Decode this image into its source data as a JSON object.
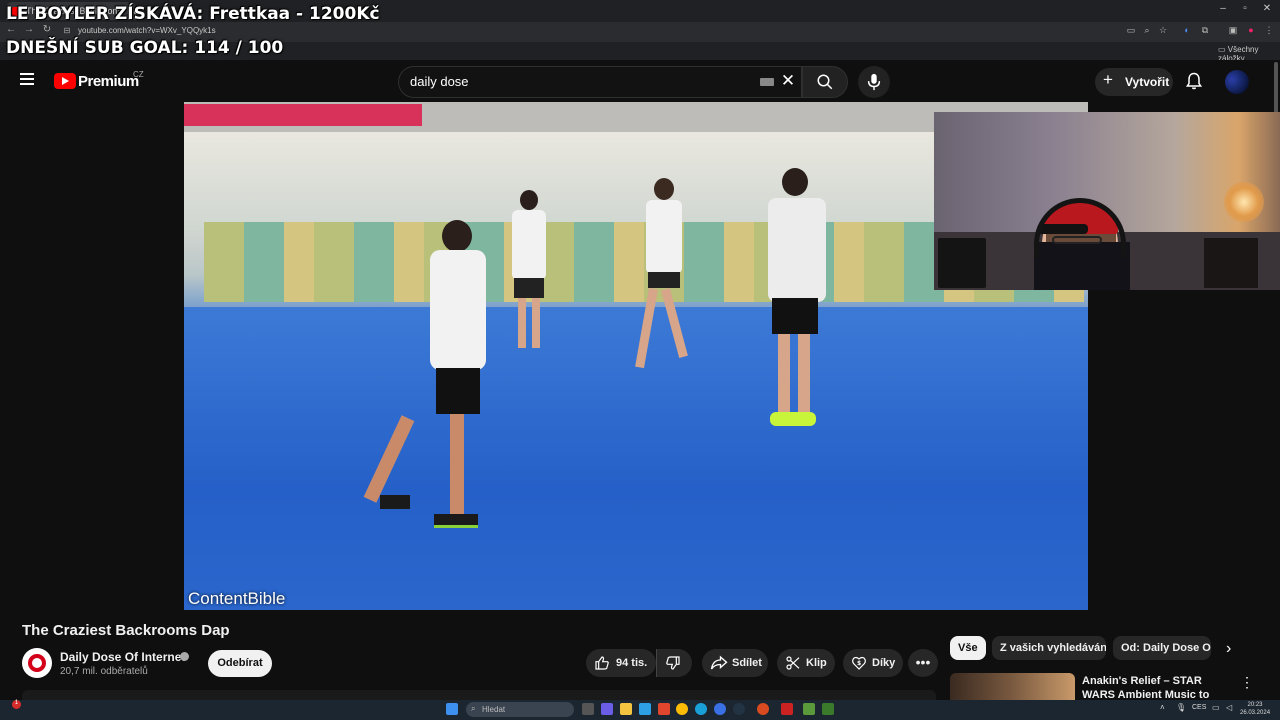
{
  "browser": {
    "tab_title": "The Craziest Backrooms Da...",
    "url": "youtube.com/watch?v=WXv_YQQyk1s",
    "bookmarks_all": "Všechny záložky"
  },
  "overlays": {
    "donation": "LE BOYLER ZÍSKÁVÁ: Frettkaa - 1200Kč",
    "subgoal": "DNEŠNÍ SUB GOAL: 114 / 100"
  },
  "header": {
    "logo_text": "Premium",
    "country": "CZ",
    "search_value": "daily dose",
    "create_label": "Vytvořit"
  },
  "video": {
    "watermark": "ContentBible",
    "title": "The Craziest Backrooms Dap"
  },
  "channel": {
    "name": "Daily Dose Of Internet",
    "subscribers": "20,7 mil. odběratelů",
    "subscribe_label": "Odebírat"
  },
  "actions": {
    "likes": "94 tis.",
    "share": "Sdílet",
    "clip": "Klip",
    "thanks": "Díky",
    "more": "•••"
  },
  "related": {
    "chips": [
      "Vše",
      "Z vašich vyhledávání",
      "Od: Daily Dose Of Internet"
    ],
    "item_title": "Anakin's Relief – STAR WARS Ambient Music to Find Peace i..."
  },
  "taskbar": {
    "search_placeholder": "Hledat",
    "lang": "CES",
    "time": "20:23",
    "date": "26.03.2024",
    "notification_count": "1"
  }
}
